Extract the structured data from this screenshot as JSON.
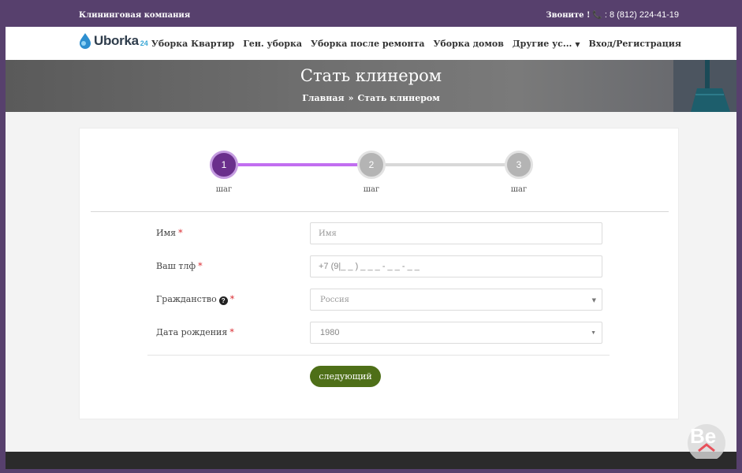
{
  "topbar": {
    "company": "Клининговая компания",
    "call_label": "Звоните !",
    "phone": ": 8 (812) 224-41-19"
  },
  "logo": {
    "text": "Uborka",
    "sub": "24"
  },
  "nav": {
    "items": [
      "Уборка Квартир",
      "Ген. уборка",
      "Уборка после ремонта",
      "Уборка домов",
      "Другие ус...",
      "Вход/Регистрация"
    ]
  },
  "banner": {
    "title": "Стать клинером",
    "crumb_home": "Главная",
    "crumb_sep": "»",
    "crumb_current": "Стать клинером"
  },
  "steps": [
    {
      "number": "1",
      "label": "шаг",
      "active": true
    },
    {
      "number": "2",
      "label": "шаг",
      "active": false
    },
    {
      "number": "3",
      "label": "шаг",
      "active": false
    }
  ],
  "form": {
    "name_label": "Имя",
    "name_placeholder": "Имя",
    "phone_label": "Ваш тлф",
    "phone_value": "+7 (9|_ _ ) _ _ _ - _ _ - _ _",
    "citizenship_label": "Гражданство",
    "citizenship_value": "Россия",
    "birth_label": "Дата рождения",
    "birth_value": "1980",
    "required_mark": "*",
    "help_icon": "?"
  },
  "next_button": "следующий",
  "colors": {
    "brand_purple": "#57406d",
    "step_active": "#6a2f8c",
    "progress": "#c16ef0",
    "button_green": "#4e6f18"
  },
  "watermark": "Be"
}
